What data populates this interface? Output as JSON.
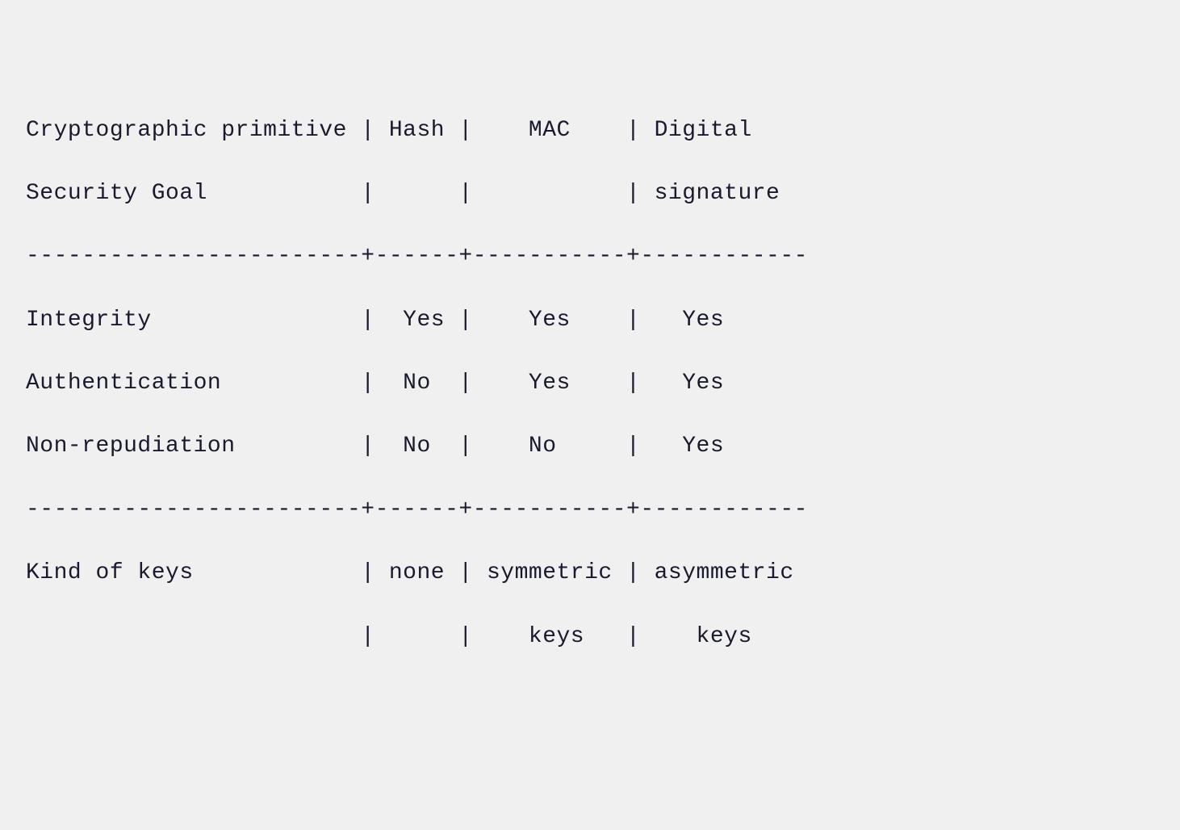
{
  "header": {
    "row1": "Cryptographic primitive | Hash |    MAC    | Digital",
    "row2": "Security Goal           |      |           | signature"
  },
  "divider": "------------------------+------+-----------+------------",
  "body": {
    "integrity": "Integrity               |  Yes |    Yes    |   Yes",
    "authentication": "Authentication          |  No  |    Yes    |   Yes",
    "nonrepudiation": "Non-repudiation         |  No  |    No     |   Yes"
  },
  "footer": {
    "row1": "Kind of keys            | none | symmetric | asymmetric",
    "row2": "                        |      |    keys   |    keys"
  },
  "chart_data": {
    "type": "table",
    "columns": [
      "Cryptographic primitive / Security Goal",
      "Hash",
      "MAC",
      "Digital signature"
    ],
    "rows": [
      {
        "label": "Integrity",
        "Hash": "Yes",
        "MAC": "Yes",
        "Digital signature": "Yes"
      },
      {
        "label": "Authentication",
        "Hash": "No",
        "MAC": "Yes",
        "Digital signature": "Yes"
      },
      {
        "label": "Non-repudiation",
        "Hash": "No",
        "MAC": "No",
        "Digital signature": "Yes"
      },
      {
        "label": "Kind of keys",
        "Hash": "none",
        "MAC": "symmetric keys",
        "Digital signature": "asymmetric keys"
      }
    ]
  }
}
